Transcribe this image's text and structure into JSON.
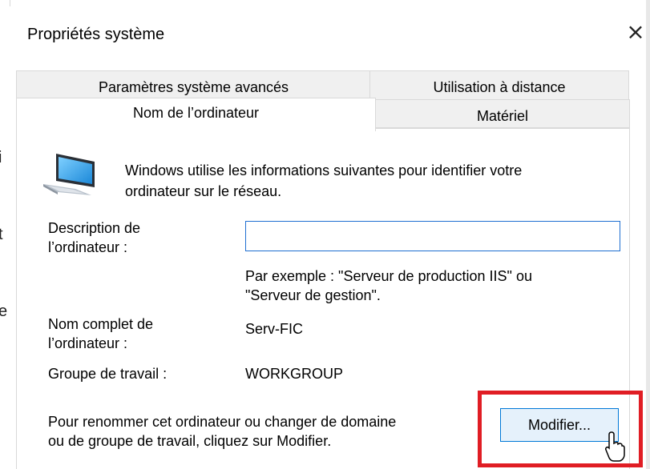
{
  "dialog": {
    "title": "Propriétés système",
    "close_glyph": "×"
  },
  "tabs": {
    "advanced": "Paramètres système avancés",
    "remote": "Utilisation à distance",
    "computer_name": "Nom de l’ordinateur",
    "hardware": "Matériel"
  },
  "panel": {
    "intro_line1": "Windows utilise les informations suivantes pour identifier votre",
    "intro_line2": "ordinateur sur le réseau.",
    "description_label_line1": "Description de",
    "description_label_line2": "l’ordinateur :",
    "description_value": "",
    "example_line1": "Par exemple : \"Serveur de production IIS\" ou",
    "example_line2": "\"Serveur de gestion\".",
    "full_name_label_line1": "Nom complet de",
    "full_name_label_line2": "l’ordinateur :",
    "full_name_value": "Serv-FIC",
    "workgroup_label": "Groupe de travail :",
    "workgroup_value": "WORKGROUP",
    "rename_hint_line1": "Pour renommer cet ordinateur ou changer de domaine",
    "rename_hint_line2": "ou de groupe de travail, cliquez sur Modifier.",
    "modify_button": "Modifier..."
  },
  "icons": {
    "computer": "computer-icon",
    "cursor": "mouse-pointer-icon"
  },
  "colors": {
    "highlight": "#e01d24",
    "button_bg": "#e5f1fb",
    "button_border": "#0078d7",
    "field_border": "#1f6fd1"
  }
}
